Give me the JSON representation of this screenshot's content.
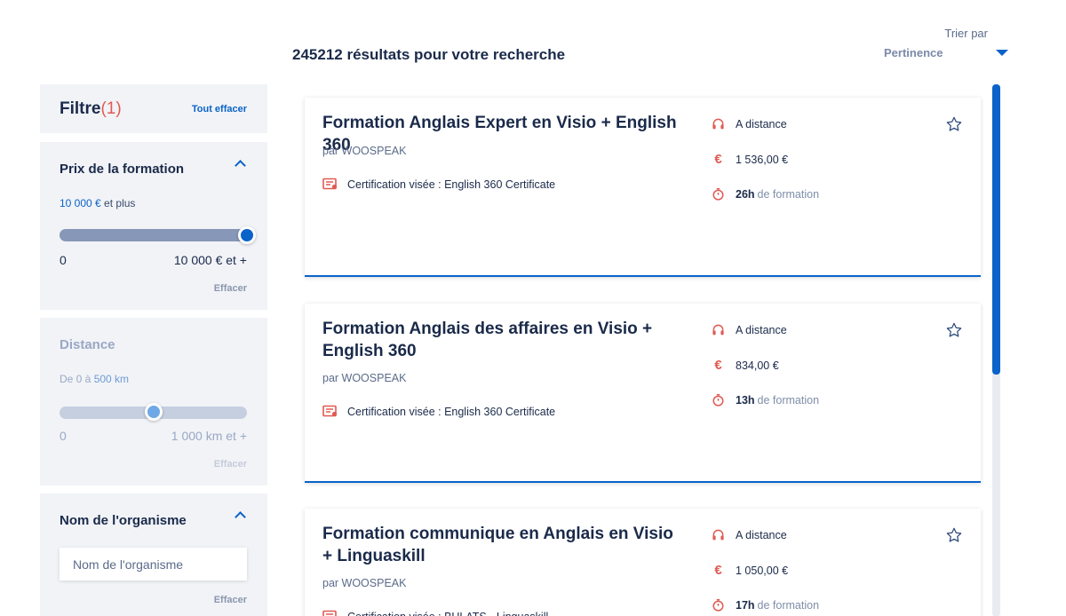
{
  "header": {
    "results_count": "245212 résultats pour votre recherche",
    "sort_label": "Trier par",
    "sort_value": "Pertinence"
  },
  "filters": {
    "title": "Filtre",
    "count": "(1)",
    "clear_all": "Tout effacer",
    "price": {
      "title": "Prix de la formation",
      "range_value": "10 000 €",
      "range_suffix": " et plus",
      "min_label": "0",
      "max_label": "10 000 € et +",
      "slider_fraction": 1.0,
      "clear": "Effacer"
    },
    "distance": {
      "title": "Distance",
      "range_prefix": "De 0 à ",
      "range_value": "500 km",
      "min_label": "0",
      "max_label": "1 000 km et +",
      "slider_fraction": 0.5,
      "clear": "Effacer"
    },
    "organisme": {
      "title": "Nom de l'organisme",
      "placeholder": "Nom de l'organisme",
      "clear": "Effacer"
    }
  },
  "cards": [
    {
      "title": "Formation Anglais Expert en Visio + English 360",
      "provider": "par WOOSPEAK",
      "certification": "Certification visée : English 360 Certificate",
      "mode": "A distance",
      "price": "1 536,00 €",
      "duration": "26h",
      "duration_suffix": "de formation"
    },
    {
      "title": "Formation Anglais des affaires en Visio + English 360",
      "provider": "par WOOSPEAK",
      "certification": "Certification visée : English 360 Certificate",
      "mode": "A distance",
      "price": "834,00 €",
      "duration": "13h",
      "duration_suffix": "de formation"
    },
    {
      "title": "Formation communique en Anglais en Visio + Linguaskill",
      "provider": "par WOOSPEAK",
      "certification": "Certification visée : BULATS - Linguaskill",
      "mode": "A distance",
      "price": "1 050,00 €",
      "duration": "17h",
      "duration_suffix": "de formation"
    }
  ],
  "colors": {
    "accent": "#0a63c8",
    "icon_red": "#e05a52",
    "text_dark": "#1a2a4a",
    "panel_bg": "#f1f3f7"
  },
  "icons": {
    "mode": "headphones-icon",
    "price": "euro-icon",
    "duration": "stopwatch-icon",
    "certification": "certificate-icon",
    "favorite": "star-icon",
    "sort": "caret-down-icon",
    "collapse": "chevron-up-icon"
  }
}
